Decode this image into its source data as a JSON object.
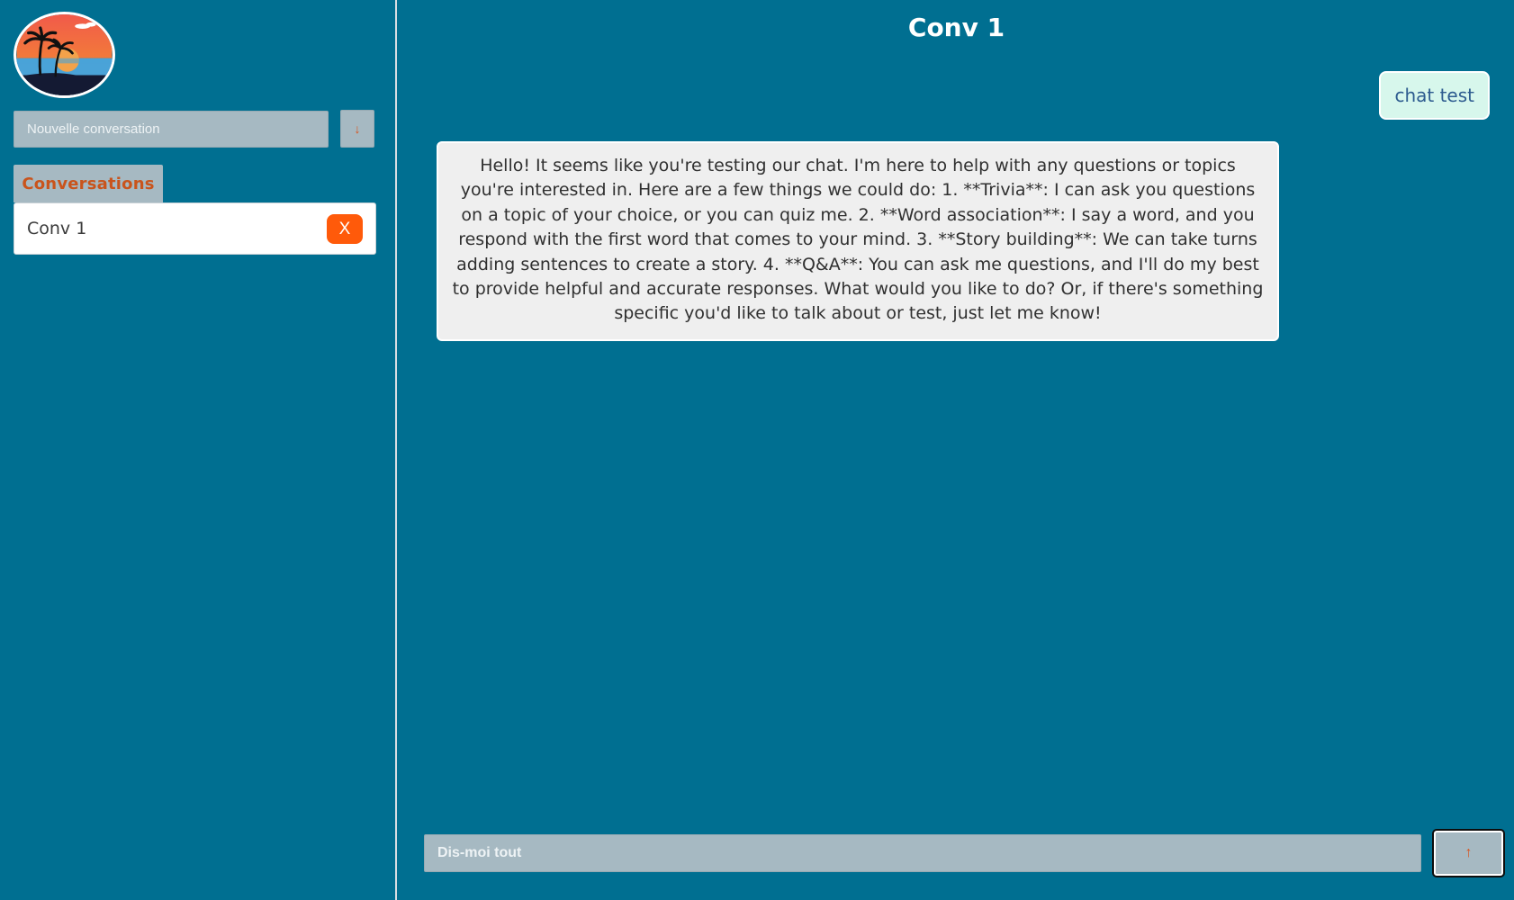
{
  "sidebar": {
    "logo_alt": "palm-island-logo",
    "new_conversation": {
      "placeholder": "Nouvelle conversation",
      "button_icon": "↓"
    },
    "conversations_tab": "Conversations",
    "conversations": [
      {
        "label": "Conv 1",
        "delete_label": "X"
      }
    ]
  },
  "main": {
    "title": "Conv 1",
    "messages": [
      {
        "role": "user",
        "text": "chat test"
      },
      {
        "role": "assistant",
        "text": "Hello! It seems like you're testing our chat. I'm here to help with any questions or topics you're interested in. Here are a few things we could do: 1. **Trivia**: I can ask you questions on a topic of your choice, or you can quiz me. 2. **Word association**: I say a word, and you respond with the first word that comes to your mind. 3. **Story building**: We can take turns adding sentences to create a story. 4. **Q&A**: You can ask me questions, and I'll do my best to provide helpful and accurate responses. What would you like to do? Or, if there's something specific you'd like to talk about or test, just let me know!"
      }
    ],
    "input": {
      "placeholder": "Dis-moi tout",
      "send_icon": "↑"
    }
  },
  "colors": {
    "background": "#006f91",
    "accent_orange": "#ff5a0a",
    "input_gray": "#a6b9c2",
    "user_bubble": "#d7f7ec",
    "bot_bubble": "#efefef"
  }
}
